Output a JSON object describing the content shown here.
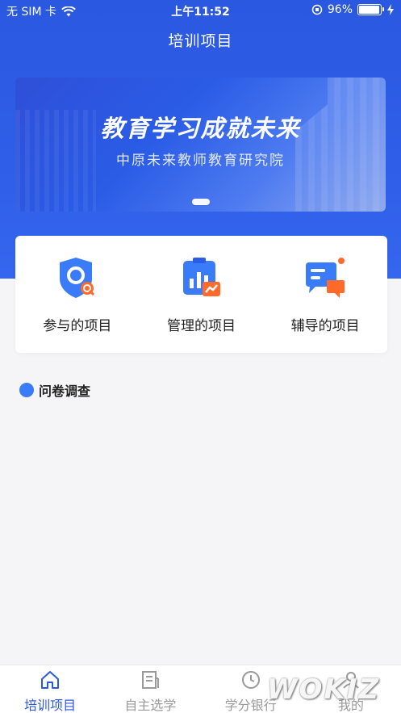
{
  "status_bar": {
    "carrier": "无 SIM 卡",
    "time": "上午11:52",
    "battery_percent": "96%",
    "battery_level": 0.96
  },
  "nav": {
    "title": "培训项目"
  },
  "banner": {
    "headline": "教育学习成就未来",
    "subline": "中原未来教师教育研究院"
  },
  "entries": [
    {
      "label": "参与的项目",
      "icon": "shield-search-icon"
    },
    {
      "label": "管理的项目",
      "icon": "chart-clipboard-icon"
    },
    {
      "label": "辅导的项目",
      "icon": "chat-bubble-icon"
    }
  ],
  "section": {
    "title": "问卷调查"
  },
  "tabbar": {
    "tabs": [
      {
        "label": "培训项目",
        "icon": "home-icon",
        "active": true
      },
      {
        "label": "自主选学",
        "icon": "document-icon",
        "active": false
      },
      {
        "label": "学分银行",
        "icon": "clock-icon",
        "active": false
      },
      {
        "label": "我的",
        "icon": "person-icon",
        "active": false
      }
    ]
  },
  "watermark": "WOKIZ",
  "colors": {
    "brand_blue": "#2b58e0",
    "accent_orange": "#ff6a2b",
    "section_dot": "#3a7bfa"
  }
}
